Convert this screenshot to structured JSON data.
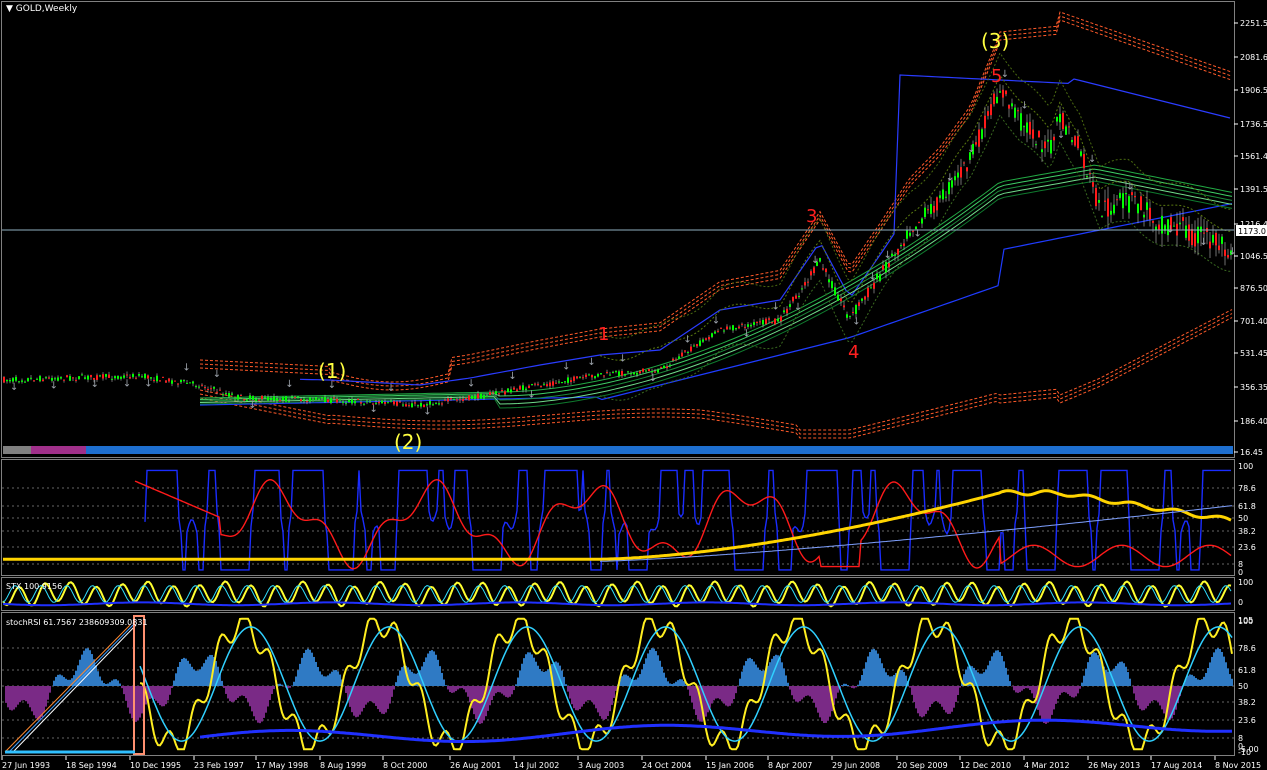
{
  "window": {
    "title": "GOLD,Weekly"
  },
  "main_chart": {
    "symbol_label": "GOLD,Weekly",
    "price_axis": [
      "2251.5",
      "2081.6",
      "1906.5",
      "1736.5",
      "1561.4",
      "1391.5",
      "1216.4",
      "1046.5",
      "876.50",
      "701.40",
      "531.45",
      "356.35",
      "186.40",
      "16.45"
    ],
    "current_price": "1173.0",
    "wave_labels": {
      "w1_yellow": "(1)",
      "w2_yellow": "(2)",
      "w3_yellow": "(3)",
      "sub1": "1",
      "sub3": "3",
      "sub4": "4",
      "sub5": "5"
    }
  },
  "indicator1": {
    "axis": [
      "100",
      "78.6",
      "61.8",
      "50",
      "38.2",
      "23.6",
      "8",
      "0"
    ]
  },
  "indicator2": {
    "label": "STX 100.9156",
    "axis": [
      "100",
      "0"
    ]
  },
  "indicator3": {
    "label": "stochRSI 61.7567 238609309.0831",
    "axis_top": [
      "100",
      "105"
    ],
    "axis": [
      "78.6",
      "61.8",
      "50",
      "38.2",
      "23.6",
      "8"
    ],
    "axis_bottom": [
      "0",
      "-5.00",
      "-10"
    ]
  },
  "time_axis": [
    "27 Jun 1993",
    "18 Sep 1994",
    "10 Dec 1995",
    "23 Feb 1997",
    "17 May 1998",
    "8 Aug 1999",
    "8 Oct 2000",
    "26 Aug 2001",
    "14 Jul 2002",
    "3 Aug 2003",
    "24 Oct 2004",
    "15 Jan 2006",
    "8 Apr 2007",
    "29 Jun 2008",
    "20 Sep 2009",
    "12 Dec 2010",
    "4 Mar 2012",
    "26 May 2013",
    "17 Aug 2014",
    "8 Nov 2015"
  ],
  "colors": {
    "background": "#000000",
    "axis": "#ffffff",
    "grid_line": "#8fb0c0",
    "candle_up": "#00ff00",
    "candle_down": "#ff0000",
    "wave_major": "#ffff40",
    "wave_minor": "#ff2020",
    "envelope": "#ff6a3a",
    "bollinger": "#1f3cff",
    "price_tag_bg": "#ffffff"
  }
}
